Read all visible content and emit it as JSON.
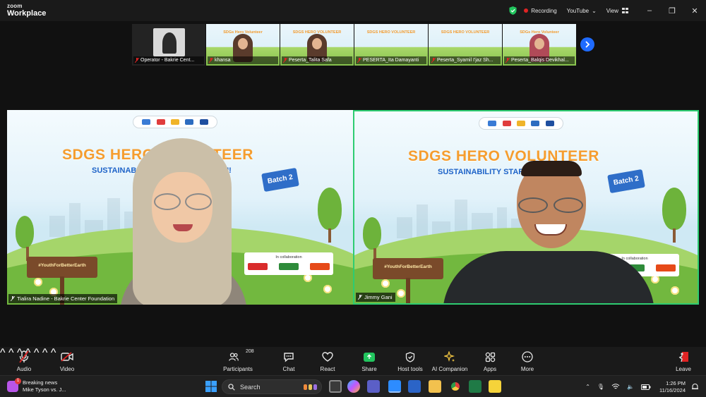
{
  "app": {
    "brand_top": "zoom",
    "brand_bottom": "Workplace"
  },
  "titlebar": {
    "recording_label": "Recording",
    "youtube_label": "YouTube",
    "view_label": "View",
    "colors": {
      "recording_dot": "#e02424",
      "shield": "#22c55e"
    }
  },
  "gallery": {
    "thumbnails": [
      {
        "name": "Operator - Bakrie Cent...",
        "type": "camera"
      },
      {
        "name": "khansa",
        "type": "slide",
        "slide_title": "SDGs Hero Volunteer"
      },
      {
        "name": "Peserta_Talita Safa",
        "type": "slide",
        "slide_title": "SDGS HERO VOLUNTEER"
      },
      {
        "name": "PESERTA_Ita Damayanti",
        "type": "slide",
        "slide_title": "SDGS HERO VOLUNTEER"
      },
      {
        "name": "Peserta_Syamil I'jaz Sh...",
        "type": "slide",
        "slide_title": "SDGS HERO VOLUNTEER"
      },
      {
        "name": "Peserta_Balqis Devikhal...",
        "type": "slide",
        "slide_title": "SDGs Hero Volunteer"
      }
    ],
    "next_icon": "chevron-right-icon",
    "accent": "#1f6bff"
  },
  "tiles": [
    {
      "name": "Tialira Nadine - Bakrie Center Foundation",
      "slide_title": "SDGS HERO VOLUNTEER",
      "slide_subtitle": "SUSTAINABILITY STARTS WITH YOU!",
      "batch": "Batch 2",
      "signboard": "#YouthForBetterEarth",
      "collab_label": "In collaboration",
      "active": false
    },
    {
      "name": "Jimmy Gani",
      "slide_title": "SDGS HERO VOLUNTEER",
      "slide_subtitle": "SUSTAINABILITY STARTS WITH YOU!",
      "batch": "Batch 2",
      "signboard": "#YouthForBetterEarth",
      "collab_label": "In collaboration",
      "active": true,
      "active_color": "#2ecc71"
    }
  ],
  "toolbar": {
    "audio": "Audio",
    "video": "Video",
    "participants": "Participants",
    "participants_count": "208",
    "chat": "Chat",
    "react": "React",
    "share": "Share",
    "host_tools": "Host tools",
    "ai_companion": "AI Companion",
    "apps": "Apps",
    "more": "More",
    "leave": "Leave",
    "colors": {
      "share": "#22c55e",
      "leave": "#e02424",
      "muted": "#e02424"
    }
  },
  "taskbar": {
    "news_title": "Breaking news",
    "news_subtitle": "Mike Tyson vs. J...",
    "news_badge": "1",
    "search_placeholder": "Search",
    "time": "1:26 PM",
    "date": "11/16/2024"
  }
}
